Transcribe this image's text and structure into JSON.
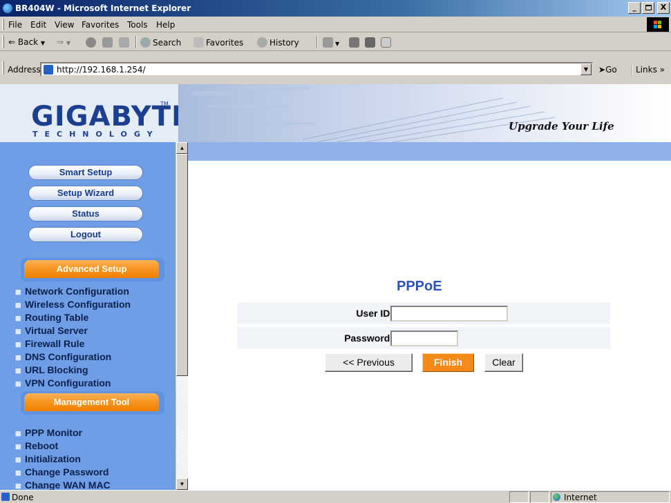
{
  "window": {
    "title": "BR404W - Microsoft Internet Explorer",
    "buttons": [
      "_",
      " ",
      "X"
    ]
  },
  "menubar": {
    "items": [
      "File",
      "Edit",
      "View",
      "Favorites",
      "Tools",
      "Help"
    ]
  },
  "toolbar": {
    "back": "Back",
    "search": "Search",
    "favorites": "Favorites",
    "history": "History"
  },
  "address": {
    "label": "Address",
    "url": "http://192.168.1.254/",
    "go": "Go",
    "links": "Links »"
  },
  "banner": {
    "logo": "GIGABYTE",
    "tm": "TM",
    "subtitle": "TECHNOLOGY",
    "slogan": "Upgrade Your Life"
  },
  "sidebar": {
    "buttons": [
      "Smart Setup",
      "Setup Wizard",
      "Status",
      "Logout"
    ],
    "advanced_title": "Advanced Setup",
    "advanced_items": [
      "Network Configuration",
      "Wireless Configuration",
      "Routing Table",
      "Virtual Server",
      "Firewall Rule",
      "DNS Configuration",
      "URL Blocking",
      "VPN Configuration"
    ],
    "management_title": "Management Tool",
    "management_items": [
      "PPP Monitor",
      "Reboot",
      "Initialization",
      "Change Password",
      "Change WAN MAC"
    ]
  },
  "form": {
    "title": "PPPoE",
    "user_id_label": "User ID:",
    "user_id_value": "",
    "password_label": "Password:",
    "password_value": "",
    "previous_button": "<< Previous",
    "finish_button": "Finish",
    "clear_button": "Clear"
  },
  "status": {
    "text": "Done",
    "zone": "Internet"
  },
  "colors": {
    "sidebar": "#6f9ee7",
    "accent_orange": "#f7941d",
    "title_blue": "#2b52b8",
    "bluebar": "#8fb1ea"
  },
  "icons": [
    "ie-icon",
    "back-icon",
    "forward-icon",
    "stop-icon",
    "refresh-icon",
    "home-icon",
    "search-icon",
    "favorites-icon",
    "history-icon",
    "mail-icon",
    "print-icon",
    "edit-icon",
    "discuss-icon",
    "go-icon",
    "internet-zone-icon"
  ]
}
